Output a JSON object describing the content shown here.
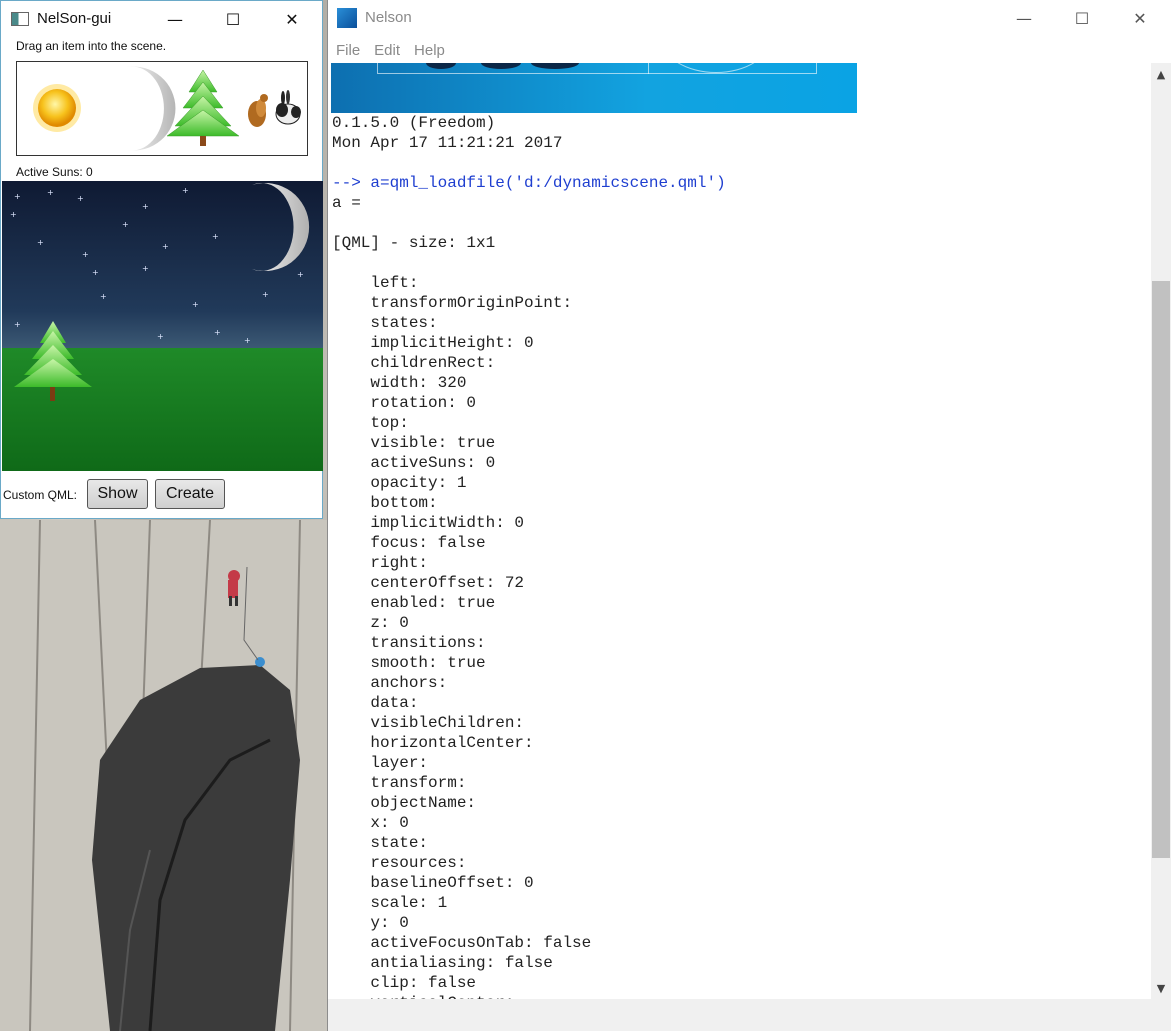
{
  "gui_window": {
    "title": "NelSon-gui",
    "instruction": "Drag an item into the scene.",
    "palette_items": [
      "sun-icon",
      "moon-icon",
      "tree-icon",
      "squirrel-icon",
      "rabbit-icon"
    ],
    "active_suns_label": "Active Suns: 0",
    "custom_qml_label": "Custom QML:",
    "show_button": "Show",
    "create_button": "Create"
  },
  "nelson_window": {
    "title": "Nelson",
    "menu": [
      "File",
      "Edit",
      "Help"
    ],
    "console_lines": [
      {
        "text": "0.1.5.0 (Freedom)",
        "kind": "out"
      },
      {
        "text": "Mon Apr 17 11:21:21 2017",
        "kind": "out"
      },
      {
        "text": "",
        "kind": "out"
      },
      {
        "text": "--> a=qml_loadfile('d:/dynamicscene.qml')",
        "kind": "cmd"
      },
      {
        "text": "a =",
        "kind": "out"
      },
      {
        "text": "",
        "kind": "out"
      },
      {
        "text": "[QML] - size: 1x1",
        "kind": "out"
      },
      {
        "text": "",
        "kind": "out"
      },
      {
        "text": "    left:",
        "kind": "out"
      },
      {
        "text": "    transformOriginPoint:",
        "kind": "out"
      },
      {
        "text": "    states:",
        "kind": "out"
      },
      {
        "text": "    implicitHeight: 0",
        "kind": "out"
      },
      {
        "text": "    childrenRect:",
        "kind": "out"
      },
      {
        "text": "    width: 320",
        "kind": "out"
      },
      {
        "text": "    rotation: 0",
        "kind": "out"
      },
      {
        "text": "    top:",
        "kind": "out"
      },
      {
        "text": "    visible: true",
        "kind": "out"
      },
      {
        "text": "    activeSuns: 0",
        "kind": "out"
      },
      {
        "text": "    opacity: 1",
        "kind": "out"
      },
      {
        "text": "    bottom:",
        "kind": "out"
      },
      {
        "text": "    implicitWidth: 0",
        "kind": "out"
      },
      {
        "text": "    focus: false",
        "kind": "out"
      },
      {
        "text": "    right:",
        "kind": "out"
      },
      {
        "text": "    centerOffset: 72",
        "kind": "out"
      },
      {
        "text": "    enabled: true",
        "kind": "out"
      },
      {
        "text": "    z: 0",
        "kind": "out"
      },
      {
        "text": "    transitions:",
        "kind": "out"
      },
      {
        "text": "    smooth: true",
        "kind": "out"
      },
      {
        "text": "    anchors:",
        "kind": "out"
      },
      {
        "text": "    data:",
        "kind": "out"
      },
      {
        "text": "    visibleChildren:",
        "kind": "out"
      },
      {
        "text": "    horizontalCenter:",
        "kind": "out"
      },
      {
        "text": "    layer:",
        "kind": "out"
      },
      {
        "text": "    transform:",
        "kind": "out"
      },
      {
        "text": "    objectName:",
        "kind": "out"
      },
      {
        "text": "    x: 0",
        "kind": "out"
      },
      {
        "text": "    state:",
        "kind": "out"
      },
      {
        "text": "    resources:",
        "kind": "out"
      },
      {
        "text": "    baselineOffset: 0",
        "kind": "out"
      },
      {
        "text": "    scale: 1",
        "kind": "out"
      },
      {
        "text": "    y: 0",
        "kind": "out"
      },
      {
        "text": "    activeFocusOnTab: false",
        "kind": "out"
      },
      {
        "text": "    antialiasing: false",
        "kind": "out"
      },
      {
        "text": "    clip: false",
        "kind": "out"
      },
      {
        "text": "    verticalCenter:",
        "kind": "out"
      }
    ]
  },
  "colors": {
    "command_text": "#1f3fd0",
    "console_text": "#222222",
    "banner": "#12a3e0",
    "sky": "#213a5a",
    "grass": "#1f8a28"
  }
}
